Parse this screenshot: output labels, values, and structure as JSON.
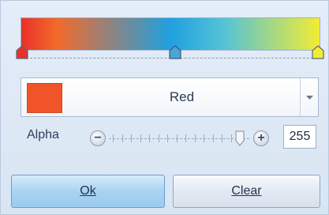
{
  "colors": {
    "stop_left": "#e8312a",
    "stop_mid": "#1fa0e0",
    "stop_right": "#f2ec35",
    "swatch": "#f05428"
  },
  "icons": {
    "dropdown": "chevron-down-icon",
    "minus": "minus-icon",
    "plus": "plus-icon",
    "thumb": "slider-thumb-icon"
  },
  "color_select": {
    "value": "Red"
  },
  "alpha": {
    "label": "Alpha",
    "value": "255",
    "level": 1.0,
    "minus_symbol": "−",
    "plus_symbol": "+"
  },
  "buttons": {
    "ok_label": "Ok",
    "clear_label": "Clear"
  }
}
